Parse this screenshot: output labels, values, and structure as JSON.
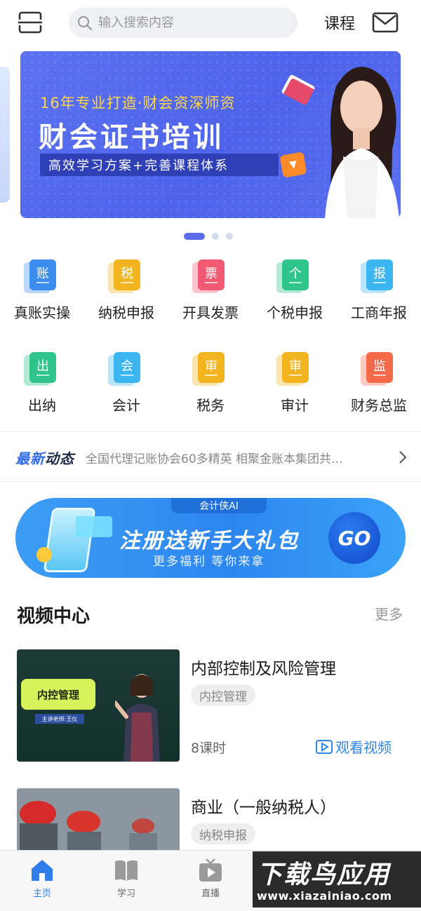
{
  "header": {
    "search_placeholder": "输入搜索内容",
    "course_link": "课程"
  },
  "banner": {
    "subtitle": "16年专业打造·财会资深师资",
    "title": "财会证书培训",
    "tagline": "高效学习方案+完善课程体系",
    "page_count": 3,
    "active_page": 1
  },
  "menu": {
    "row1": [
      {
        "label": "真账实操",
        "glyph": "账",
        "color": "#3b8ef0"
      },
      {
        "label": "纳税申报",
        "glyph": "税",
        "color": "#f2b51f"
      },
      {
        "label": "开具发票",
        "glyph": "票",
        "color": "#f25a72"
      },
      {
        "label": "个税申报",
        "glyph": "个",
        "color": "#2fc48a"
      },
      {
        "label": "工商年报",
        "glyph": "报",
        "color": "#3cb6f0"
      }
    ],
    "row2": [
      {
        "label": "出纳",
        "glyph": "出",
        "color": "#2fc48a"
      },
      {
        "label": "会计",
        "glyph": "会",
        "color": "#3cb6f0"
      },
      {
        "label": "税务",
        "glyph": "审",
        "color": "#f2b51f"
      },
      {
        "label": "审计",
        "glyph": "审",
        "color": "#f2b51f"
      },
      {
        "label": "财务总监",
        "glyph": "监",
        "color": "#f26a4a"
      }
    ]
  },
  "news": {
    "badge_a": "最新",
    "badge_b": "动态",
    "text": "全国代理记账协会60多精英 相聚金账本集团共…"
  },
  "promo": {
    "tag": "会计侠AI",
    "title": "注册送新手大礼包",
    "subtitle": "更多福利  等你来拿",
    "go": "GO"
  },
  "video_center": {
    "title": "视频中心",
    "more": "更多",
    "items": [
      {
        "title": "内部控制及风险管理",
        "tag": "内控管理",
        "hours": "8课时",
        "watch": "观看视频",
        "board_text": "内控管理",
        "name_text": "主讲老师:王仪"
      },
      {
        "title": "商业（一般纳税人）",
        "tag": "纳税申报"
      }
    ]
  },
  "bottom_nav": [
    {
      "label": "主页",
      "icon": "home-icon",
      "active": true
    },
    {
      "label": "学习",
      "icon": "book-icon",
      "active": false
    },
    {
      "label": "直播",
      "icon": "tv-play-icon",
      "active": false
    }
  ],
  "watermark": {
    "main": "下载鸟应用",
    "url": "www.xiazainiao.com"
  },
  "colors": {
    "accent": "#2f7de8",
    "banner_blue": "#4d63ea",
    "promo_blue": "#2d86ef"
  }
}
